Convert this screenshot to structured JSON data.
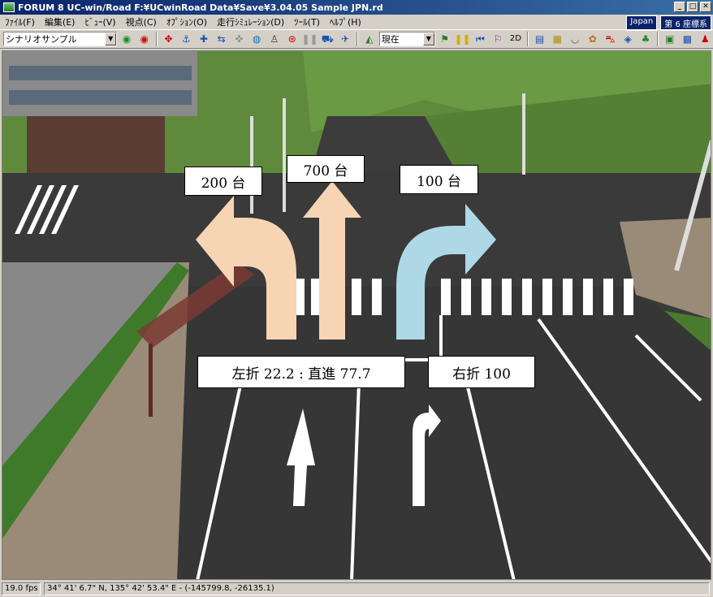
{
  "window": {
    "title": "FORUM 8    UC-win/Road    F:¥UCwinRoad Data¥Save¥3.04.05 Sample JPN.rd",
    "minimize": "_",
    "maximize": "□",
    "close": "✕"
  },
  "menu": {
    "items": [
      "ﾌｧｲﾙ(F)",
      "編集(E)",
      "ﾋﾞｭｰ(V)",
      "視点(C)",
      "ｵﾌﾟｼｮﾝ(O)",
      "走行ｼﾐｭﾚｰｼｮﾝ(D)",
      "ﾂｰﾙ(T)",
      "ﾍﾙﾌﾟ(H)"
    ],
    "region": "Japan",
    "coord_system": "第 6 座標系"
  },
  "toolbar": {
    "scenario_select": "シナリオサンプル",
    "time_select": "現在",
    "mode_2d": "2D"
  },
  "scene": {
    "counts": {
      "left": "200 台",
      "straight": "700 台",
      "right": "100 台"
    },
    "ratios": {
      "left_straight": "左折 22.2 : 直進 77.7",
      "right": "右折 100"
    },
    "colors": {
      "left_straight_arrow": "#f7d4b4",
      "right_arrow": "#aed8e6"
    }
  },
  "status": {
    "fps": "19.0 fps",
    "latlon": "34°  41' 6.7\" N, 135°  42' 53.4\" E  -  (-145799.8, -26135.1)"
  }
}
